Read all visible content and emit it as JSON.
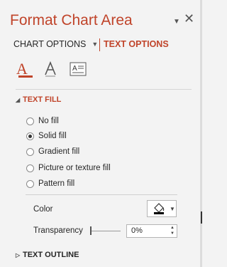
{
  "pane": {
    "title": "Format Chart Area",
    "pin_icon": "triangle-down-icon",
    "close_icon": "close-icon"
  },
  "tabs": {
    "chart_options": "CHART OPTIONS",
    "text_options": "TEXT OPTIONS",
    "active": "TEXT OPTIONS"
  },
  "icons": [
    "text-fill-icon",
    "text-outline-icon",
    "text-box-icon"
  ],
  "text_fill": {
    "header": "TEXT FILL",
    "options": [
      {
        "label": "No fill",
        "checked": false
      },
      {
        "label": "Solid fill",
        "checked": true
      },
      {
        "label": "Gradient fill",
        "checked": false
      },
      {
        "label": "Picture or texture fill",
        "checked": false
      },
      {
        "label": "Pattern fill",
        "checked": false
      }
    ],
    "color_label": "Color",
    "transparency_label": "Transparency",
    "transparency_value": "0%"
  },
  "text_outline": {
    "header": "TEXT OUTLINE"
  },
  "colors": {
    "accent": "#c0442a",
    "background": "#f3f3f3"
  }
}
